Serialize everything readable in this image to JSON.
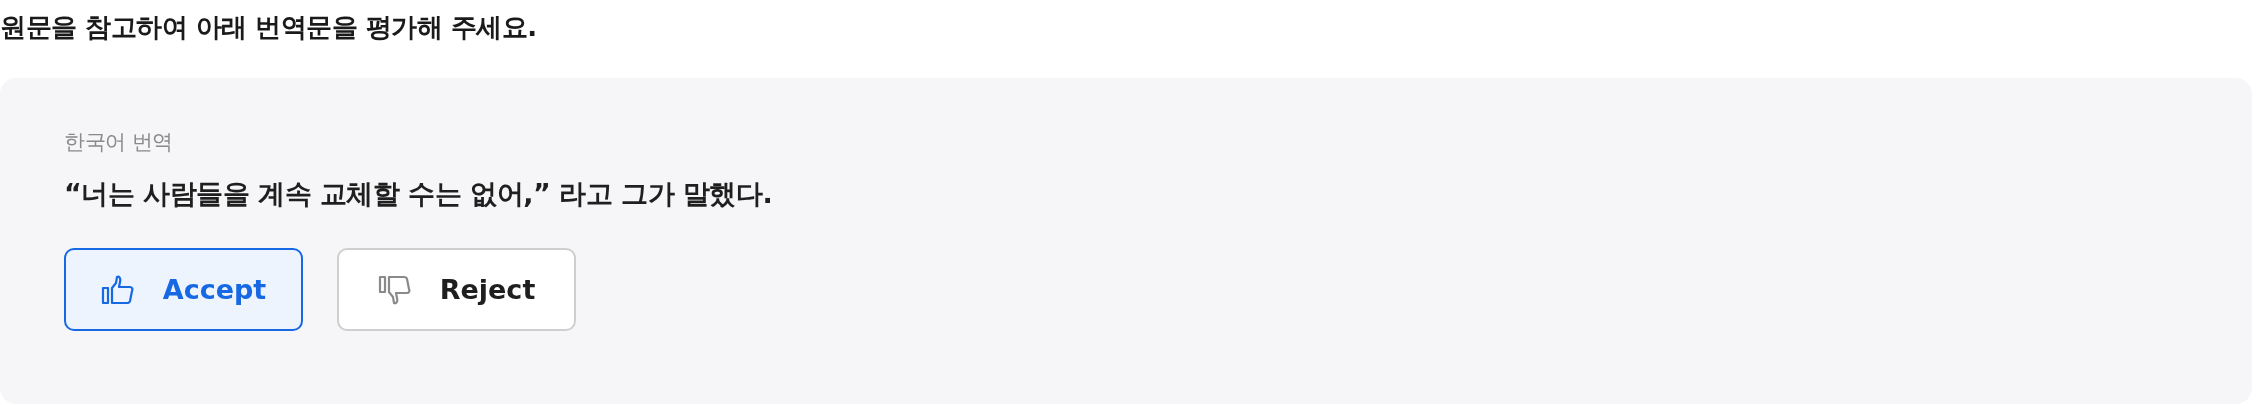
{
  "prompt": "원문을 참고하여 아래 번역문을 평가해 주세요.",
  "card": {
    "label": "한국어 번역",
    "translation": "“너는 사람들을 계속 교체할 수는 없어,” 라고 그가 말했다."
  },
  "buttons": [
    {
      "kind": "accept",
      "label": "Accept",
      "selected": true
    },
    {
      "kind": "reject",
      "label": "Reject",
      "selected": false
    }
  ]
}
